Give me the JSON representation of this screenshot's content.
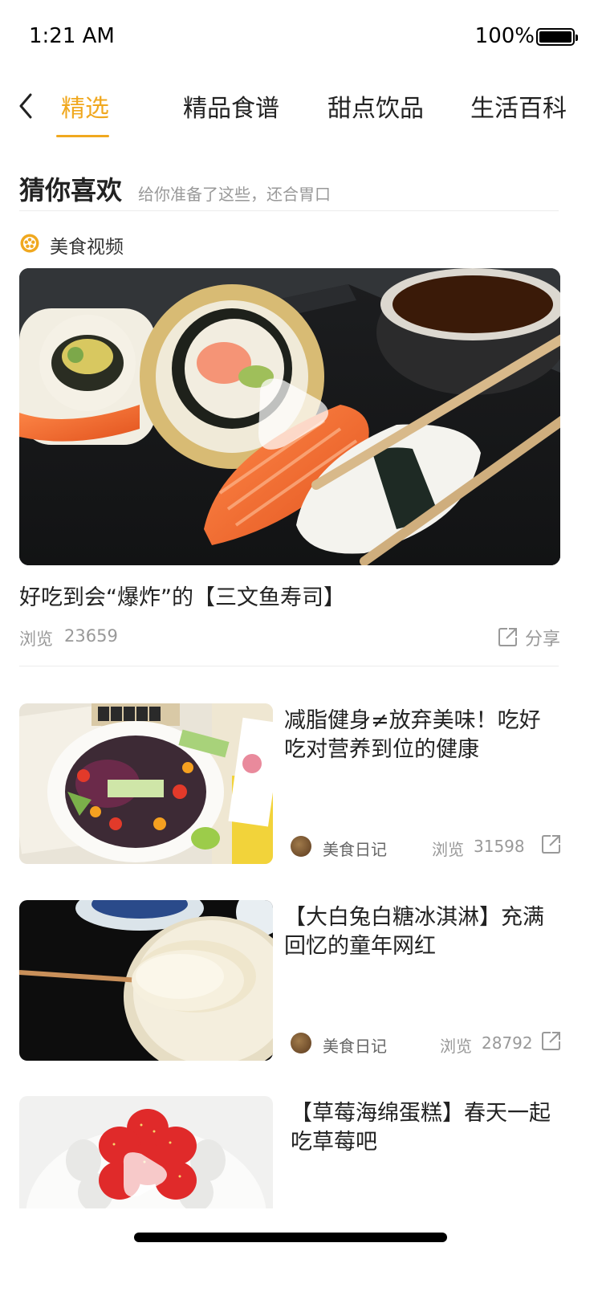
{
  "status_bar": {
    "time": "1:21 AM",
    "battery": "100%"
  },
  "tabs": [
    {
      "label": "精选",
      "active": true
    },
    {
      "label": "精品食谱",
      "active": false
    },
    {
      "label": "甜点饮品",
      "active": false
    },
    {
      "label": "生活百科",
      "active": false
    }
  ],
  "section": {
    "title": "猜你喜欢",
    "subtitle": "给你准备了这些，还合胃口"
  },
  "category": {
    "label": "美食视频",
    "icon": "food-video-icon"
  },
  "hero": {
    "title": "好吃到会“爆炸”的【三文鱼寿司】",
    "views_label": "浏览",
    "views": "23659",
    "share_label": "分享"
  },
  "cards": [
    {
      "title": "减脂健身≠放弃美味！吃好吃对营养到位的健康",
      "author": "美食日记",
      "views_label": "浏览",
      "views": "31598"
    },
    {
      "title": "【大白兔白糖冰淇淋】充满回忆的童年网红",
      "author": "美食日记",
      "views_label": "浏览",
      "views": "28792"
    },
    {
      "title": "【草莓海绵蛋糕】春天一起吃草莓吧"
    }
  ],
  "colors": {
    "accent": "#f0a81f",
    "text": "#222222",
    "muted": "#999999"
  }
}
